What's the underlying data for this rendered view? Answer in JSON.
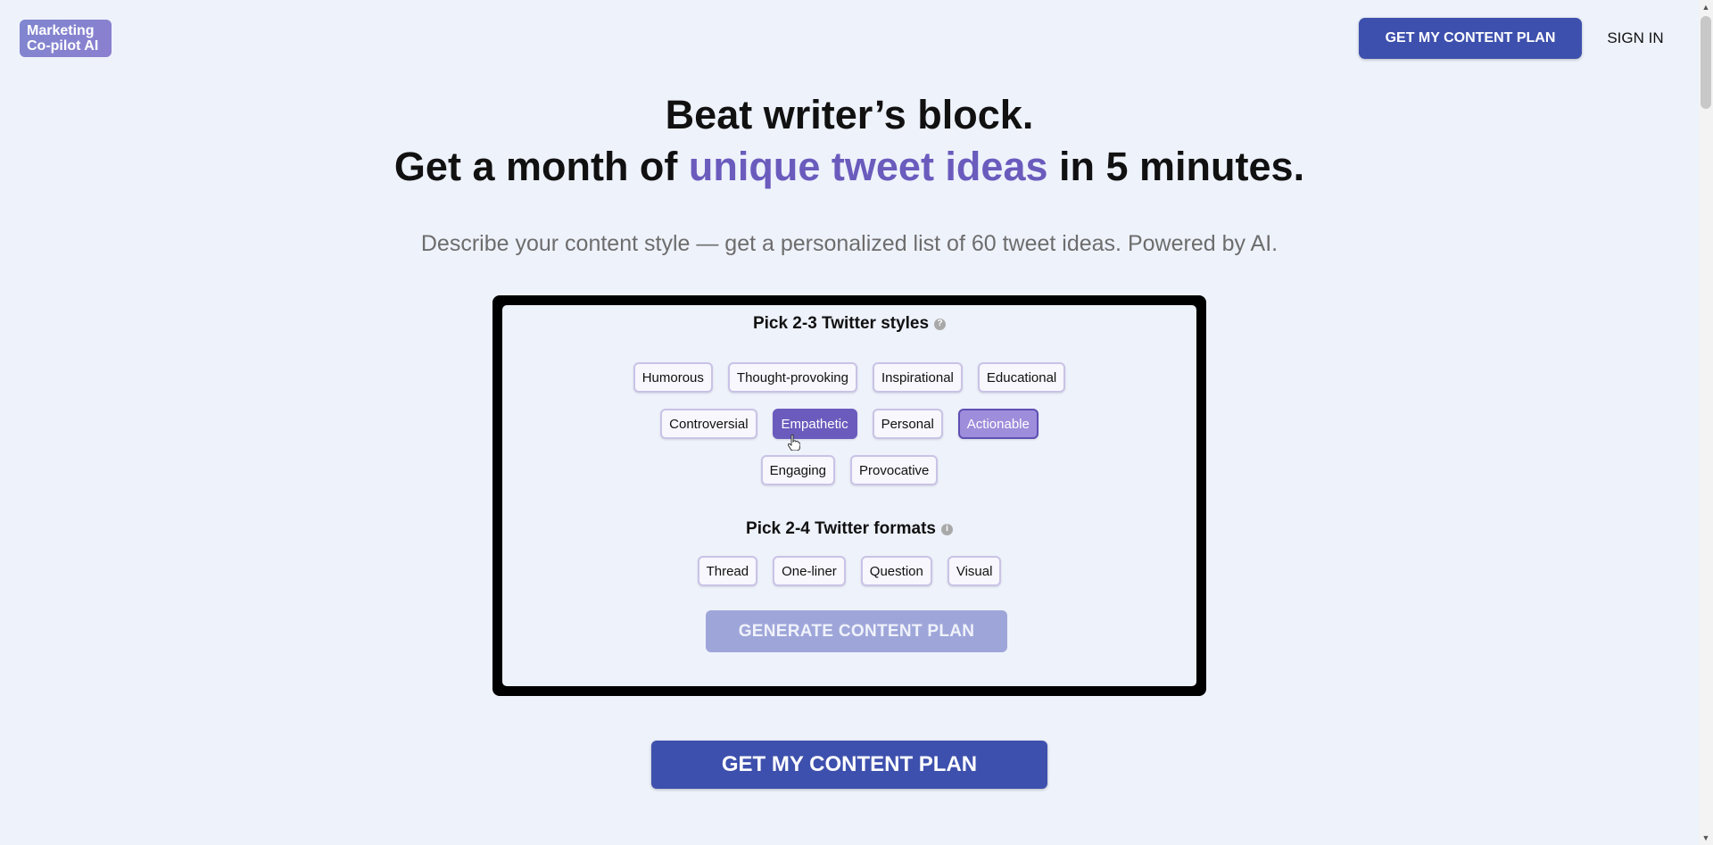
{
  "header": {
    "logo_line1": "Marketing",
    "logo_line2": "Co-pilot AI",
    "cta_label": "GET MY CONTENT PLAN",
    "signin_label": "SIGN IN"
  },
  "hero": {
    "line1": "Beat writer’s block.",
    "line2_pre": "Get a month of ",
    "line2_accent": "unique tweet ideas",
    "line2_post": " in 5 minutes.",
    "subtitle": "Describe your content style — get a personalized list of 60 tweet ideas. Powered by AI."
  },
  "styles": {
    "title": "Pick 2-3 Twitter styles",
    "help_icon": "question-circle-icon",
    "rows": [
      [
        {
          "label": "Humorous",
          "state": "default"
        },
        {
          "label": "Thought-provoking",
          "state": "default"
        },
        {
          "label": "Inspirational",
          "state": "default"
        },
        {
          "label": "Educational",
          "state": "default"
        }
      ],
      [
        {
          "label": "Controversial",
          "state": "default"
        },
        {
          "label": "Empathetic",
          "state": "selected"
        },
        {
          "label": "Personal",
          "state": "default"
        },
        {
          "label": "Actionable",
          "state": "selected-hover"
        }
      ],
      [
        {
          "label": "Engaging",
          "state": "default"
        },
        {
          "label": "Provocative",
          "state": "default"
        }
      ]
    ]
  },
  "formats": {
    "title": "Pick 2-4 Twitter formats",
    "info_icon": "info-circle-icon",
    "items": [
      {
        "label": "Thread"
      },
      {
        "label": "One-liner"
      },
      {
        "label": "Question"
      },
      {
        "label": "Visual"
      }
    ]
  },
  "generate_label": "GENERATE CONTENT PLAN",
  "main_cta_label": "GET MY CONTENT PLAN",
  "colors": {
    "background": "#eef2fb",
    "primary": "#3e50ad",
    "accent": "#6a5bbd",
    "disabled_button": "#9ea6d9"
  }
}
